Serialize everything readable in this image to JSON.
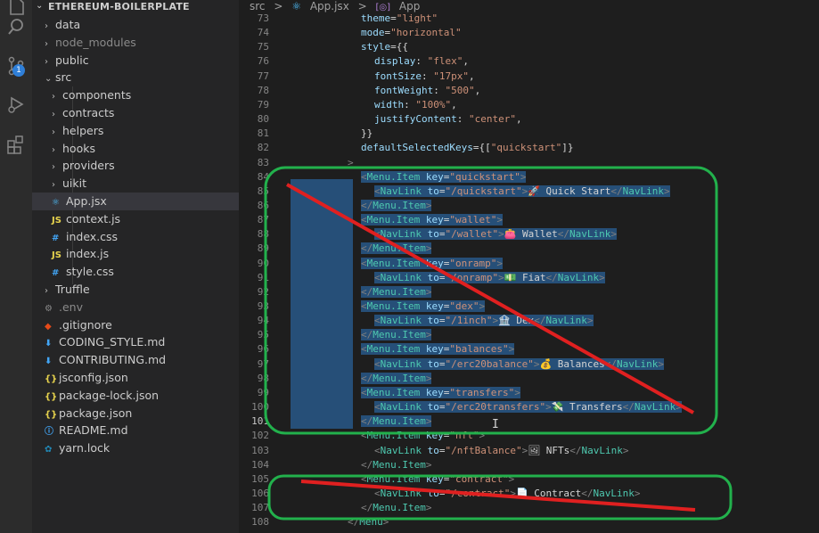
{
  "activity_bar": {
    "scm_badge": "1",
    "icons": [
      "files-icon",
      "search-icon",
      "source-control-icon",
      "run-debug-icon",
      "extensions-icon"
    ]
  },
  "explorer": {
    "title": "ETHEREUM-BOILERPLATE",
    "items": [
      {
        "label": "data",
        "kind": "folder",
        "depth": 0,
        "icon": ""
      },
      {
        "label": "node_modules",
        "kind": "folder",
        "depth": 0,
        "icon": "",
        "dim": true
      },
      {
        "label": "public",
        "kind": "folder",
        "depth": 0,
        "icon": ""
      },
      {
        "label": "src",
        "kind": "folder-open",
        "depth": 0,
        "icon": ""
      },
      {
        "label": "components",
        "kind": "folder",
        "depth": 1,
        "icon": ""
      },
      {
        "label": "contracts",
        "kind": "folder",
        "depth": 1,
        "icon": ""
      },
      {
        "label": "helpers",
        "kind": "folder",
        "depth": 1,
        "icon": ""
      },
      {
        "label": "hooks",
        "kind": "folder",
        "depth": 1,
        "icon": ""
      },
      {
        "label": "providers",
        "kind": "folder",
        "depth": 1,
        "icon": ""
      },
      {
        "label": "uikit",
        "kind": "folder",
        "depth": 1,
        "icon": ""
      },
      {
        "label": "App.jsx",
        "kind": "file",
        "depth": 1,
        "icon": "react",
        "selected": true
      },
      {
        "label": "context.js",
        "kind": "file",
        "depth": 1,
        "icon": "js"
      },
      {
        "label": "index.css",
        "kind": "file",
        "depth": 1,
        "icon": "css"
      },
      {
        "label": "index.js",
        "kind": "file",
        "depth": 1,
        "icon": "js"
      },
      {
        "label": "style.css",
        "kind": "file",
        "depth": 1,
        "icon": "css"
      },
      {
        "label": "Truffle",
        "kind": "folder",
        "depth": 0,
        "icon": ""
      },
      {
        "label": ".env",
        "kind": "file",
        "depth": 0,
        "icon": "gear",
        "dim": true
      },
      {
        "label": ".gitignore",
        "kind": "file",
        "depth": 0,
        "icon": "git"
      },
      {
        "label": "CODING_STYLE.md",
        "kind": "file",
        "depth": 0,
        "icon": "md-down"
      },
      {
        "label": "CONTRIBUTING.md",
        "kind": "file",
        "depth": 0,
        "icon": "md-down"
      },
      {
        "label": "jsconfig.json",
        "kind": "file",
        "depth": 0,
        "icon": "json"
      },
      {
        "label": "package-lock.json",
        "kind": "file",
        "depth": 0,
        "icon": "json"
      },
      {
        "label": "package.json",
        "kind": "file",
        "depth": 0,
        "icon": "json"
      },
      {
        "label": "README.md",
        "kind": "file",
        "depth": 0,
        "icon": "info"
      },
      {
        "label": "yarn.lock",
        "kind": "file",
        "depth": 0,
        "icon": "yarn"
      }
    ]
  },
  "breadcrumb": {
    "root": "src",
    "sep": ">",
    "file": "App.jsx",
    "symbol": "App"
  },
  "editor": {
    "lines": [
      {
        "n": "73",
        "tokens": [
          [
            "k",
            "theme"
          ],
          [
            "p",
            "="
          ],
          [
            "s",
            "\"light\""
          ]
        ],
        "indent": 1
      },
      {
        "n": "74",
        "tokens": [
          [
            "k",
            "mode"
          ],
          [
            "p",
            "="
          ],
          [
            "s",
            "\"horizontal\""
          ]
        ],
        "indent": 1
      },
      {
        "n": "75",
        "tokens": [
          [
            "k",
            "style"
          ],
          [
            "p",
            "={{"
          ]
        ],
        "indent": 1
      },
      {
        "n": "76",
        "tokens": [
          [
            "k",
            "display"
          ],
          [
            "p",
            ": "
          ],
          [
            "s",
            "\"flex\""
          ],
          [
            "p",
            ","
          ]
        ],
        "indent": 2
      },
      {
        "n": "77",
        "tokens": [
          [
            "k",
            "fontSize"
          ],
          [
            "p",
            ": "
          ],
          [
            "s",
            "\"17px\""
          ],
          [
            "p",
            ","
          ]
        ],
        "indent": 2
      },
      {
        "n": "78",
        "tokens": [
          [
            "k",
            "fontWeight"
          ],
          [
            "p",
            ": "
          ],
          [
            "s",
            "\"500\""
          ],
          [
            "p",
            ","
          ]
        ],
        "indent": 2
      },
      {
        "n": "79",
        "tokens": [
          [
            "k",
            "width"
          ],
          [
            "p",
            ": "
          ],
          [
            "s",
            "\"100%\""
          ],
          [
            "p",
            ","
          ]
        ],
        "indent": 2
      },
      {
        "n": "80",
        "tokens": [
          [
            "k",
            "justifyContent"
          ],
          [
            "p",
            ": "
          ],
          [
            "s",
            "\"center\""
          ],
          [
            "p",
            ","
          ]
        ],
        "indent": 2
      },
      {
        "n": "81",
        "tokens": [
          [
            "p",
            "}}"
          ]
        ],
        "indent": 1
      },
      {
        "n": "82",
        "tokens": [
          [
            "k",
            "defaultSelectedKeys"
          ],
          [
            "p",
            "={["
          ],
          [
            "s",
            "\"quickstart\""
          ],
          [
            "p",
            "]}"
          ]
        ],
        "indent": 1
      },
      {
        "n": "83",
        "tokens": [
          [
            "g",
            ">"
          ]
        ],
        "indent": 0
      },
      {
        "n": "84",
        "tokens": [
          [
            "g",
            "<"
          ],
          [
            "c",
            "Menu.Item"
          ],
          [
            "p",
            " "
          ],
          [
            "k",
            "key"
          ],
          [
            "p",
            "="
          ],
          [
            "s",
            "\"quickstart\""
          ],
          [
            "g",
            ">"
          ]
        ],
        "indent": 1,
        "sel": true
      },
      {
        "n": "85",
        "tokens": [
          [
            "g",
            "<"
          ],
          [
            "c",
            "NavLink"
          ],
          [
            "p",
            " "
          ],
          [
            "k",
            "to"
          ],
          [
            "p",
            "="
          ],
          [
            "s",
            "\"/quickstart\""
          ],
          [
            "g",
            ">"
          ],
          [
            "p",
            "🚀 Quick Start"
          ],
          [
            "g",
            "</"
          ],
          [
            "c",
            "NavLink"
          ],
          [
            "g",
            ">"
          ]
        ],
        "indent": 2,
        "sel": true
      },
      {
        "n": "86",
        "tokens": [
          [
            "g",
            "</"
          ],
          [
            "c",
            "Menu.Item"
          ],
          [
            "g",
            ">"
          ]
        ],
        "indent": 1,
        "sel": true
      },
      {
        "n": "87",
        "tokens": [
          [
            "g",
            "<"
          ],
          [
            "c",
            "Menu.Item"
          ],
          [
            "p",
            " "
          ],
          [
            "k",
            "key"
          ],
          [
            "p",
            "="
          ],
          [
            "s",
            "\"wallet\""
          ],
          [
            "g",
            ">"
          ]
        ],
        "indent": 1,
        "sel": true
      },
      {
        "n": "88",
        "tokens": [
          [
            "g",
            "<"
          ],
          [
            "c",
            "NavLink"
          ],
          [
            "p",
            " "
          ],
          [
            "k",
            "to"
          ],
          [
            "p",
            "="
          ],
          [
            "s",
            "\"/wallet\""
          ],
          [
            "g",
            ">"
          ],
          [
            "p",
            "👛 Wallet"
          ],
          [
            "g",
            "</"
          ],
          [
            "c",
            "NavLink"
          ],
          [
            "g",
            ">"
          ]
        ],
        "indent": 2,
        "sel": true
      },
      {
        "n": "89",
        "tokens": [
          [
            "g",
            "</"
          ],
          [
            "c",
            "Menu.Item"
          ],
          [
            "g",
            ">"
          ]
        ],
        "indent": 1,
        "sel": true
      },
      {
        "n": "90",
        "tokens": [
          [
            "g",
            "<"
          ],
          [
            "c",
            "Menu.Item"
          ],
          [
            "p",
            " "
          ],
          [
            "k",
            "key"
          ],
          [
            "p",
            "="
          ],
          [
            "s",
            "\"onramp\""
          ],
          [
            "g",
            ">"
          ]
        ],
        "indent": 1,
        "sel": true
      },
      {
        "n": "91",
        "tokens": [
          [
            "g",
            "<"
          ],
          [
            "c",
            "NavLink"
          ],
          [
            "p",
            " "
          ],
          [
            "k",
            "to"
          ],
          [
            "p",
            "="
          ],
          [
            "s",
            "\"/onramp\""
          ],
          [
            "g",
            ">"
          ],
          [
            "p",
            "💵 Fiat"
          ],
          [
            "g",
            "</"
          ],
          [
            "c",
            "NavLink"
          ],
          [
            "g",
            ">"
          ]
        ],
        "indent": 2,
        "sel": true
      },
      {
        "n": "92",
        "tokens": [
          [
            "g",
            "</"
          ],
          [
            "c",
            "Menu.Item"
          ],
          [
            "g",
            ">"
          ]
        ],
        "indent": 1,
        "sel": true
      },
      {
        "n": "93",
        "tokens": [
          [
            "g",
            "<"
          ],
          [
            "c",
            "Menu.Item"
          ],
          [
            "p",
            " "
          ],
          [
            "k",
            "key"
          ],
          [
            "p",
            "="
          ],
          [
            "s",
            "\"dex\""
          ],
          [
            "g",
            ">"
          ]
        ],
        "indent": 1,
        "sel": true
      },
      {
        "n": "94",
        "tokens": [
          [
            "g",
            "<"
          ],
          [
            "c",
            "NavLink"
          ],
          [
            "p",
            " "
          ],
          [
            "k",
            "to"
          ],
          [
            "p",
            "="
          ],
          [
            "s",
            "\"/1inch\""
          ],
          [
            "g",
            ">"
          ],
          [
            "p",
            "🏦 Dex"
          ],
          [
            "g",
            "</"
          ],
          [
            "c",
            "NavLink"
          ],
          [
            "g",
            ">"
          ]
        ],
        "indent": 2,
        "sel": true
      },
      {
        "n": "95",
        "tokens": [
          [
            "g",
            "</"
          ],
          [
            "c",
            "Menu.Item"
          ],
          [
            "g",
            ">"
          ]
        ],
        "indent": 1,
        "sel": true
      },
      {
        "n": "96",
        "tokens": [
          [
            "g",
            "<"
          ],
          [
            "c",
            "Menu.Item"
          ],
          [
            "p",
            " "
          ],
          [
            "k",
            "key"
          ],
          [
            "p",
            "="
          ],
          [
            "s",
            "\"balances\""
          ],
          [
            "g",
            ">"
          ]
        ],
        "indent": 1,
        "sel": true
      },
      {
        "n": "97",
        "tokens": [
          [
            "g",
            "<"
          ],
          [
            "c",
            "NavLink"
          ],
          [
            "p",
            " "
          ],
          [
            "k",
            "to"
          ],
          [
            "p",
            "="
          ],
          [
            "s",
            "\"/erc20balance\""
          ],
          [
            "g",
            ">"
          ],
          [
            "p",
            "💰 Balances"
          ],
          [
            "g",
            "</"
          ],
          [
            "c",
            "NavLink"
          ],
          [
            "g",
            ">"
          ]
        ],
        "indent": 2,
        "sel": true
      },
      {
        "n": "98",
        "tokens": [
          [
            "g",
            "</"
          ],
          [
            "c",
            "Menu.Item"
          ],
          [
            "g",
            ">"
          ]
        ],
        "indent": 1,
        "sel": true
      },
      {
        "n": "99",
        "tokens": [
          [
            "g",
            "<"
          ],
          [
            "c",
            "Menu.Item"
          ],
          [
            "p",
            " "
          ],
          [
            "k",
            "key"
          ],
          [
            "p",
            "="
          ],
          [
            "s",
            "\"transfers\""
          ],
          [
            "g",
            ">"
          ]
        ],
        "indent": 1,
        "sel": true
      },
      {
        "n": "100",
        "tokens": [
          [
            "g",
            "<"
          ],
          [
            "c",
            "NavLink"
          ],
          [
            "p",
            " "
          ],
          [
            "k",
            "to"
          ],
          [
            "p",
            "="
          ],
          [
            "s",
            "\"/erc20transfers\""
          ],
          [
            "g",
            ">"
          ],
          [
            "p",
            "💸 Transfers"
          ],
          [
            "g",
            "</"
          ],
          [
            "c",
            "NavLink"
          ],
          [
            "g",
            ">"
          ]
        ],
        "indent": 2,
        "sel": true
      },
      {
        "n": "101",
        "tokens": [
          [
            "g",
            "</"
          ],
          [
            "c",
            "Menu.Item"
          ],
          [
            "g",
            ">"
          ]
        ],
        "indent": 1,
        "sel": true,
        "current": true
      },
      {
        "n": "102",
        "tokens": [
          [
            "g",
            "<"
          ],
          [
            "c",
            "Menu.Item"
          ],
          [
            "p",
            " "
          ],
          [
            "k",
            "key"
          ],
          [
            "p",
            "="
          ],
          [
            "s",
            "\"nft\""
          ],
          [
            "g",
            ">"
          ]
        ],
        "indent": 1
      },
      {
        "n": "103",
        "tokens": [
          [
            "g",
            "<"
          ],
          [
            "c",
            "NavLink"
          ],
          [
            "p",
            " "
          ],
          [
            "k",
            "to"
          ],
          [
            "p",
            "="
          ],
          [
            "s",
            "\"/nftBalance\""
          ],
          [
            "g",
            ">"
          ],
          [
            "p",
            "🖼 NFTs"
          ],
          [
            "g",
            "</"
          ],
          [
            "c",
            "NavLink"
          ],
          [
            "g",
            ">"
          ]
        ],
        "indent": 2
      },
      {
        "n": "104",
        "tokens": [
          [
            "g",
            "</"
          ],
          [
            "c",
            "Menu.Item"
          ],
          [
            "g",
            ">"
          ]
        ],
        "indent": 1
      },
      {
        "n": "105",
        "tokens": [
          [
            "g",
            "<"
          ],
          [
            "c",
            "Menu.Item"
          ],
          [
            "p",
            " "
          ],
          [
            "k",
            "key"
          ],
          [
            "p",
            "="
          ],
          [
            "s",
            "\"contract\""
          ],
          [
            "g",
            ">"
          ]
        ],
        "indent": 1
      },
      {
        "n": "106",
        "tokens": [
          [
            "g",
            "<"
          ],
          [
            "c",
            "NavLink"
          ],
          [
            "p",
            " "
          ],
          [
            "k",
            "to"
          ],
          [
            "p",
            "="
          ],
          [
            "s",
            "\"/contract\""
          ],
          [
            "g",
            ">"
          ],
          [
            "p",
            "📄 Contract"
          ],
          [
            "g",
            "</"
          ],
          [
            "c",
            "NavLink"
          ],
          [
            "g",
            ">"
          ]
        ],
        "indent": 2
      },
      {
        "n": "107",
        "tokens": [
          [
            "g",
            "</"
          ],
          [
            "c",
            "Menu.Item"
          ],
          [
            "g",
            ">"
          ]
        ],
        "indent": 1
      },
      {
        "n": "108",
        "tokens": [
          [
            "g",
            "</"
          ],
          [
            "c",
            "Menu"
          ],
          [
            "g",
            ">"
          ]
        ],
        "indent": 0
      }
    ]
  },
  "annotations": {
    "box_color": "#22b14c",
    "strike_color": "#e02020"
  }
}
